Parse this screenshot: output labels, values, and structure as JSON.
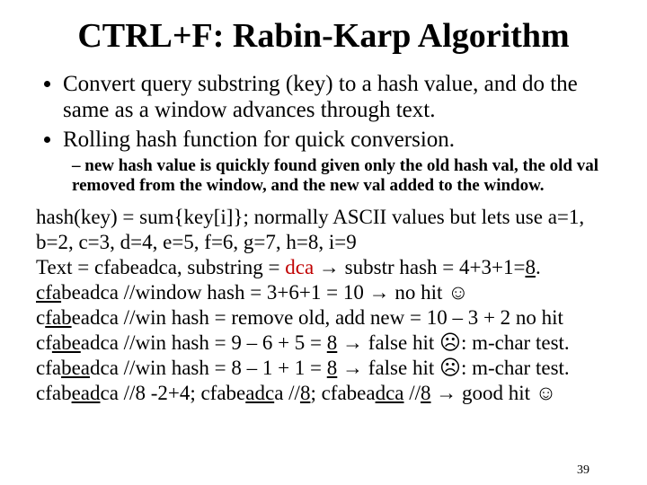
{
  "title": "CTRL+F: Rabin-Karp Algorithm",
  "bullets": {
    "b1": "Convert query substring (key) to a hash value, and do the same as a window advances through text.",
    "b2": "Rolling hash function for quick conversion.",
    "sub1": "new hash value is quickly found given only the old hash val, the old val removed from the window, and the new val added to the window."
  },
  "hashline": {
    "prefix": "hash(key) = sum{key[i]}; normally ASCII values but lets use a=1, b=2, c=3, d=4, e=5, f=6, g=7, h=8, i=9"
  },
  "text_label": "Text = cfabeadca, substring = ",
  "substr": "dca",
  "arrow": " → ",
  "substr_hash_label": "substr hash = ",
  "substr_hash_expr": "4+3+1=",
  "eight_a": "8",
  "l1_pre": "cfa",
  "l1_rest": "beadca //window hash = 3+6+1 = 10 → no hit ☺",
  "l2_u": "fab",
  "l2_pre": "c",
  "l2_rest": "eadca //win hash = remove old, add new = 10 – 3 + 2 no hit",
  "l3_pre": "cf",
  "l3_u": "abe",
  "l3_rest_a": "adca //win hash = 9 – 6 + 5 = ",
  "eight_b": "8",
  "l3_rest_b": " → false hit ☹: m-char test.",
  "l4_pre": "cfa",
  "l4_u": "bea",
  "l4_rest_a": "dca //win hash = 8 – 1 + 1 = ",
  "eight_c": "8",
  "l4_rest_b": " → false hit ☹: m-char test.",
  "l5_a_pre": "cfab",
  "l5_a_u": "ead",
  "l5_a_post": "ca //8 -2+4; cfabe",
  "l5_b_u": "adc",
  "l5_b_post": "a //",
  "eight_d": "8",
  "l5_c_mid": "; cfabea",
  "l5_c_u": "dca",
  "l5_c_post": " //",
  "eight_e": "8",
  "l5_tail": " → good hit ☺",
  "page": "39"
}
